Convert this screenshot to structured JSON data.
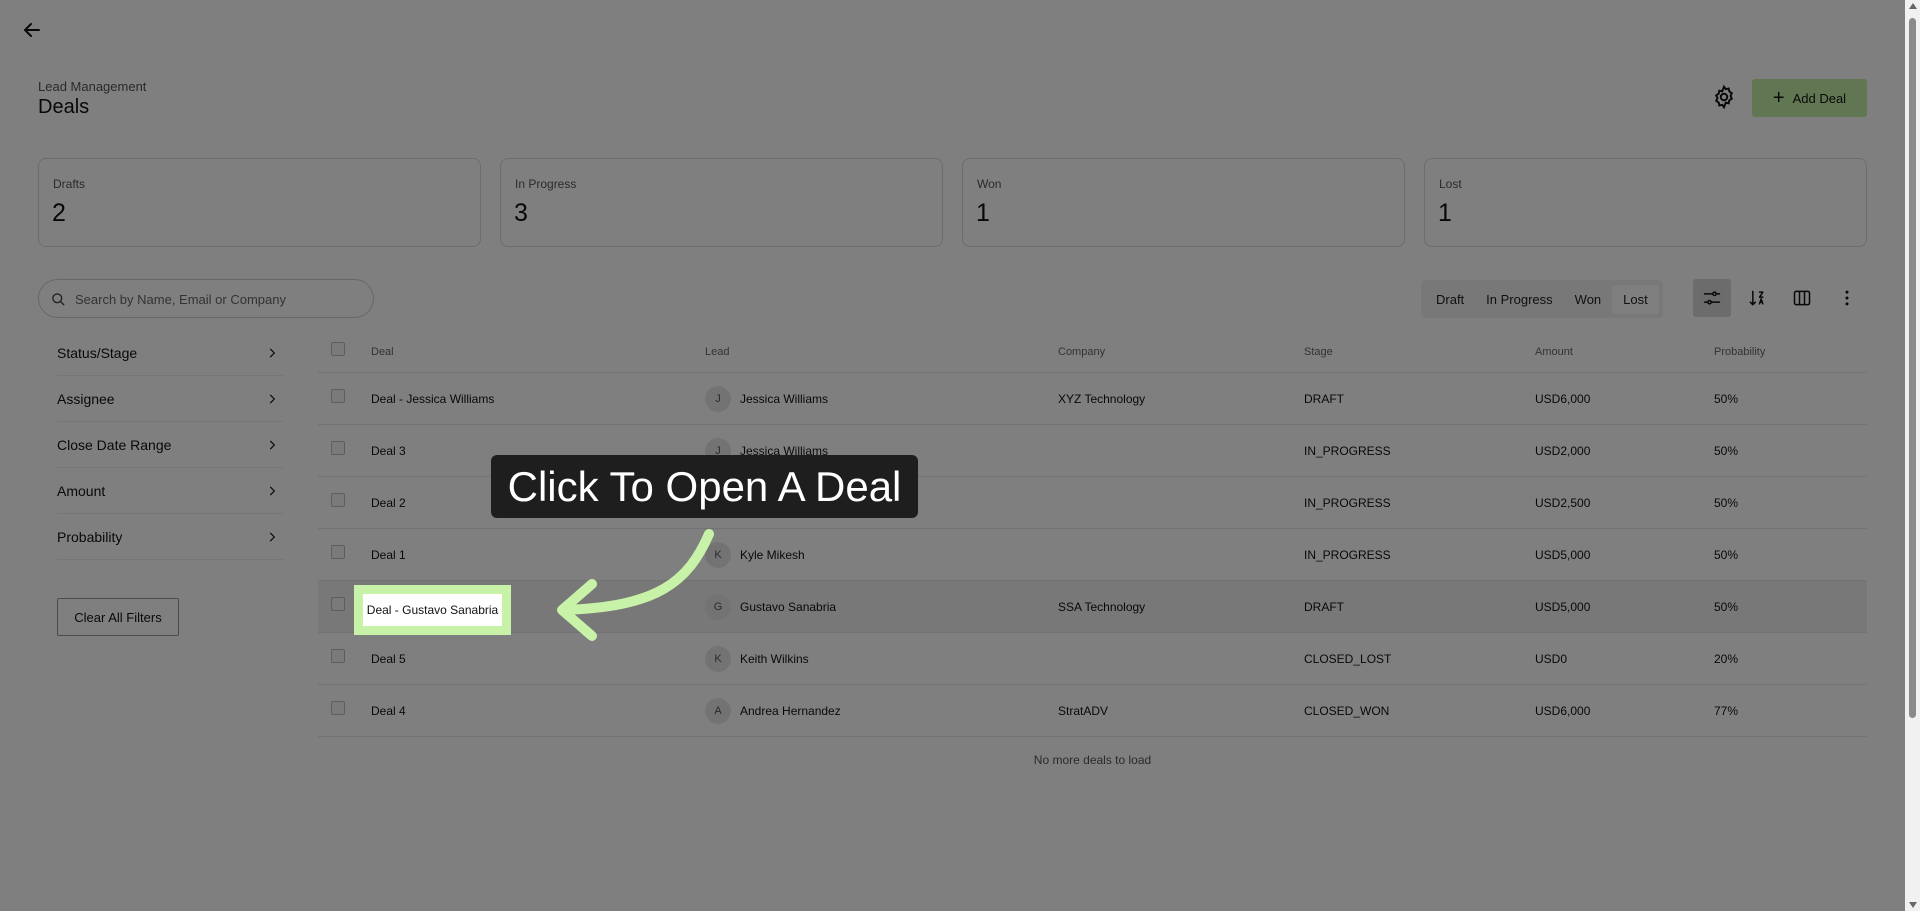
{
  "header": {
    "breadcrumb": "Lead Management",
    "title": "Deals",
    "add_deal_label": "Add Deal"
  },
  "stats": [
    {
      "label": "Drafts",
      "value": "2"
    },
    {
      "label": "In Progress",
      "value": "3"
    },
    {
      "label": "Won",
      "value": "1"
    },
    {
      "label": "Lost",
      "value": "1"
    }
  ],
  "search": {
    "placeholder": "Search by Name, Email or Company",
    "value": ""
  },
  "stage_tabs": [
    "Draft",
    "In Progress",
    "Won",
    "Lost"
  ],
  "active_stage_tab": "Lost",
  "filters": [
    "Status/Stage",
    "Assignee",
    "Close Date Range",
    "Amount",
    "Probability"
  ],
  "clear_filters_label": "Clear All Filters",
  "table": {
    "columns": [
      "Deal",
      "Lead",
      "Company",
      "Stage",
      "Amount",
      "Probability"
    ],
    "rows": [
      {
        "deal": "Deal - Jessica Williams",
        "initial": "J",
        "lead": "Jessica Williams",
        "company": "XYZ Technology",
        "stage": "DRAFT",
        "amount": "USD6,000",
        "probability": "50%"
      },
      {
        "deal": "Deal 3",
        "initial": "J",
        "lead": "Jessica Williams",
        "company": "",
        "stage": "IN_PROGRESS",
        "amount": "USD2,000",
        "probability": "50%"
      },
      {
        "deal": "Deal 2",
        "initial": "",
        "lead": "",
        "company": "",
        "stage": "IN_PROGRESS",
        "amount": "USD2,500",
        "probability": "50%"
      },
      {
        "deal": "Deal 1",
        "initial": "K",
        "lead": "Kyle Mikesh",
        "company": "",
        "stage": "IN_PROGRESS",
        "amount": "USD5,000",
        "probability": "50%"
      },
      {
        "deal": "Deal - Gustavo Sanabria",
        "initial": "G",
        "lead": "Gustavo Sanabria",
        "company": "SSA Technology",
        "stage": "DRAFT",
        "amount": "USD5,000",
        "probability": "50%"
      },
      {
        "deal": "Deal 5",
        "initial": "K",
        "lead": "Keith Wilkins",
        "company": "",
        "stage": "CLOSED_LOST",
        "amount": "USD0",
        "probability": "20%"
      },
      {
        "deal": "Deal 4",
        "initial": "A",
        "lead": "Andrea Hernandez",
        "company": "StratADV",
        "stage": "CLOSED_WON",
        "amount": "USD6,000",
        "probability": "77%"
      }
    ],
    "footer_note": "No more deals to load"
  },
  "guide": {
    "tooltip": "Click To Open A Deal",
    "highlighted_deal": "Deal - Gustavo Sanabria",
    "accent_color": "#c8f2a8"
  },
  "colors": {
    "add_button_bg": "#c3efa6",
    "tooltip_bg": "#1e1e1e"
  },
  "icons": [
    "back-arrow-icon",
    "settings-gear-icon",
    "plus-icon",
    "search-icon",
    "chevron-right-icon",
    "filter-sliders-icon",
    "sort-icon",
    "columns-icon",
    "more-vertical-icon"
  ]
}
